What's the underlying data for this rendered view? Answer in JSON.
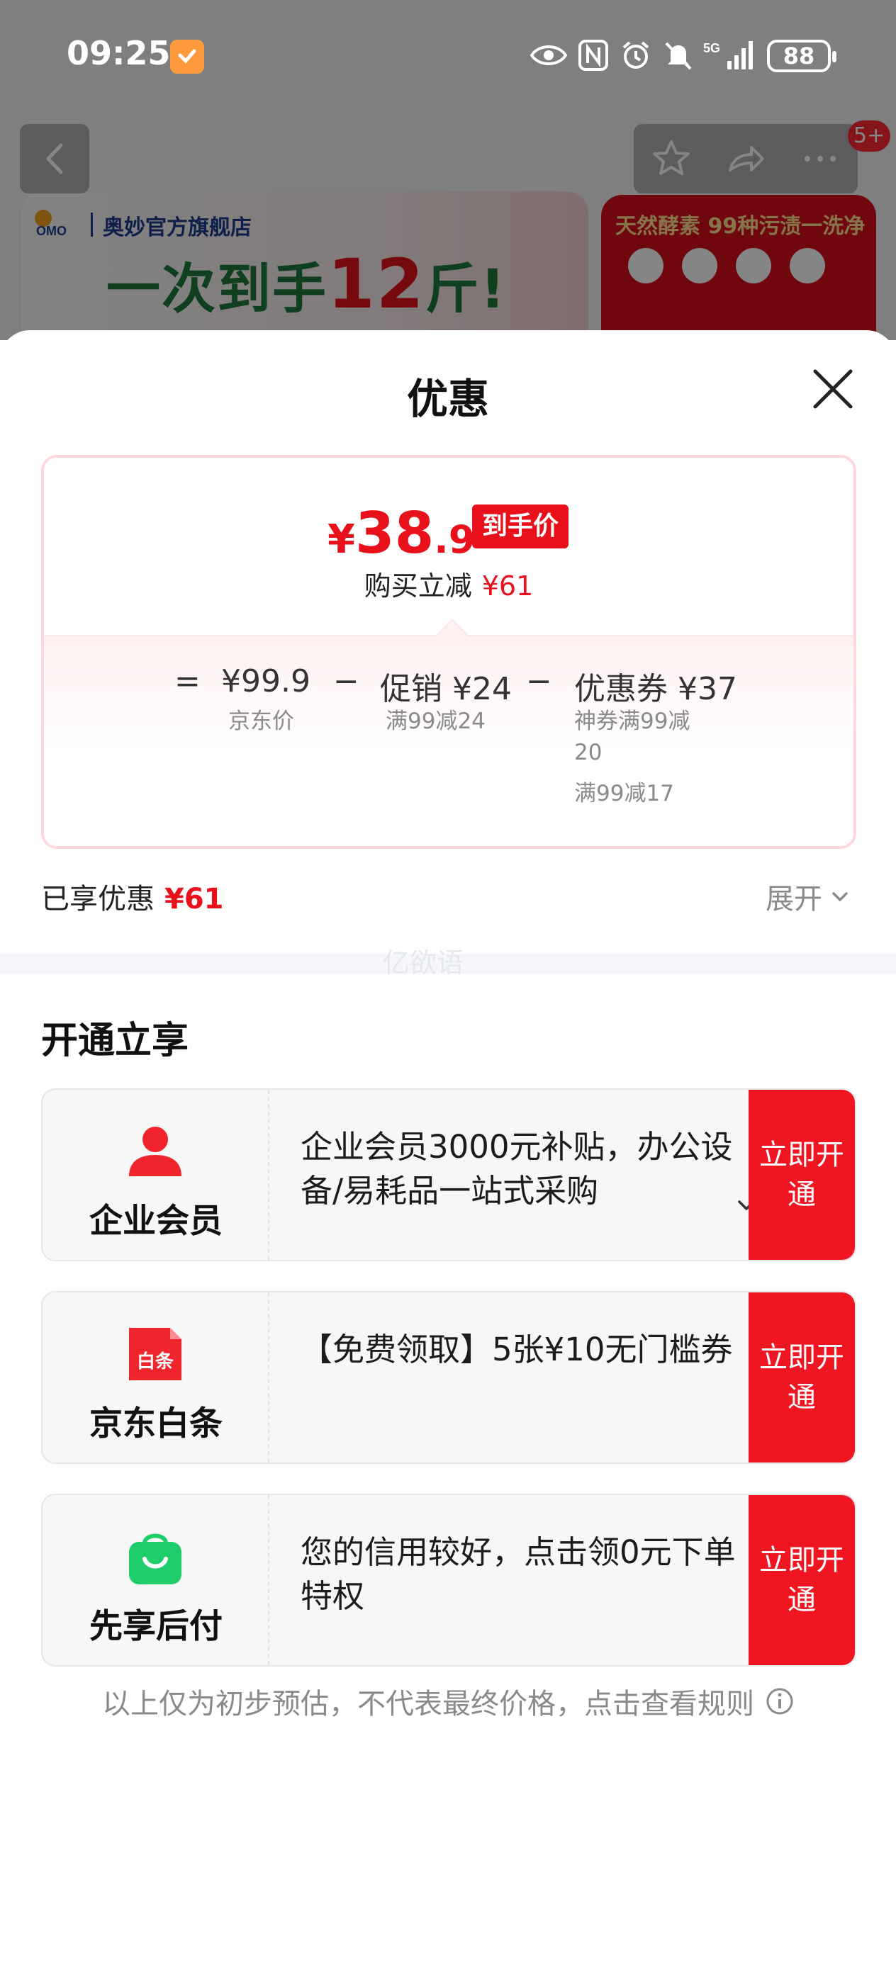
{
  "status_bar": {
    "time": "09:25",
    "network": "5G",
    "battery": "88"
  },
  "background": {
    "brand_name": "奥妙官方旗舰店",
    "brand_logo_text": "OMO",
    "slogan_prefix": "一次到手",
    "slogan_number": "12",
    "slogan_suffix": "斤!",
    "right_banner_text": "天然酵素 99种污渍一洗净",
    "notification_badge": "5+"
  },
  "sheet": {
    "title": "优惠",
    "price_card": {
      "currency": "¥",
      "price_int": "38",
      "price_dec": ".9",
      "price_tag": "到手价",
      "reduce_label": "购买立减",
      "reduce_value": "¥61",
      "equals": "=",
      "minus": "−",
      "base_price": "¥99.9",
      "base_label": "京东价",
      "promo_price": "促销 ¥24",
      "promo_detail": "满99减24",
      "coupon_price": "优惠券 ¥37",
      "coupon_detail_1": "神券满99减20",
      "coupon_detail_2": "满99减17"
    },
    "enjoyed_label": "已享优惠",
    "enjoyed_value": "¥61",
    "expand_label": "展开",
    "watermark": "亿欲语",
    "section_title": "开通立享",
    "offers": [
      {
        "name": "企业会员",
        "icon": "person-icon",
        "desc": "企业会员3000元补贴，办公设备/易耗品一站式采购",
        "button": "立即开通"
      },
      {
        "name": "京东白条",
        "icon": "baitiao-icon",
        "icon_text": "白条",
        "desc": "【免费领取】5张¥10无门槛券",
        "button": "立即开通"
      },
      {
        "name": "先享后付",
        "icon": "shopping-bag-icon",
        "desc": "您的信用较好，点击领0元下单特权",
        "button": "立即开通"
      }
    ],
    "footer_note": "以上仅为初步预估，不代表最终价格，点击查看规则"
  },
  "colors": {
    "accent": "#e8101b",
    "button": "#f01621",
    "bag_green": "#1fce6a"
  }
}
